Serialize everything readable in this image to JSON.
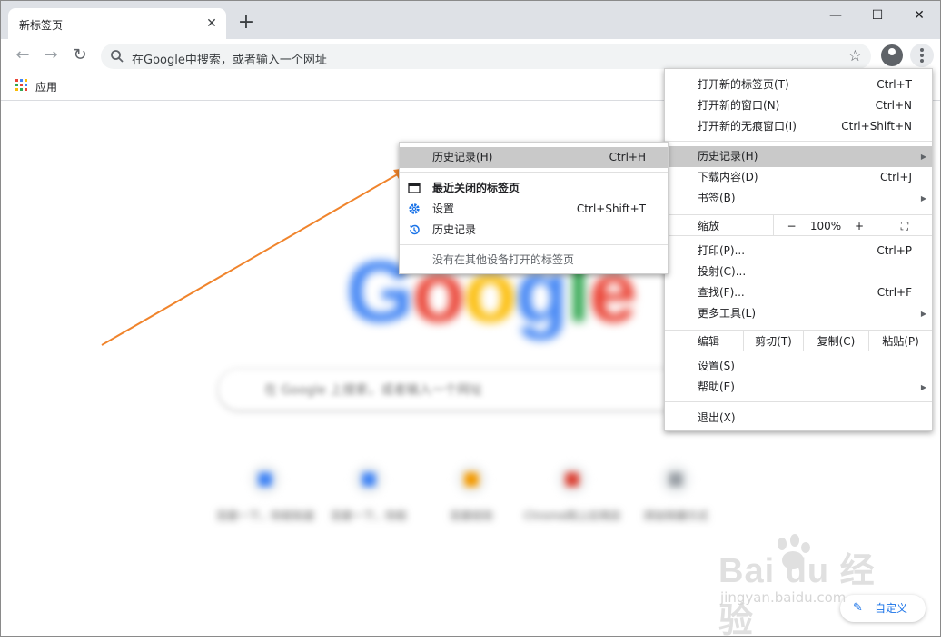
{
  "tab": {
    "title": "新标签页",
    "close": "✕",
    "new_tab": "+"
  },
  "window_controls": {
    "minimize": "—",
    "maximize": "☐",
    "close": "✕"
  },
  "omnibox": {
    "placeholder": "在Google中搜索，或者输入一个网址"
  },
  "bookmarks_bar": {
    "apps_label": "应用"
  },
  "page": {
    "logo": [
      "G",
      "o",
      "o",
      "g",
      "l",
      "e"
    ],
    "logo_colors": [
      "#4285f4",
      "#ea4335",
      "#fbbc05",
      "#4285f4",
      "#34a853",
      "#ea4335"
    ],
    "search_placeholder": "在 Google 上搜索，或者输入一个网址",
    "shortcuts": [
      {
        "label": "百度一下，你就知道",
        "color": "#4285f4"
      },
      {
        "label": "百度一下，你就",
        "color": "#4285f4"
      },
      {
        "label": "百度经验",
        "color": "#f29900"
      },
      {
        "label": "Chrome网上应用店",
        "color": "#db4437"
      },
      {
        "label": "添加快捷方式",
        "color": "#9aa0a6"
      }
    ],
    "customize_label": "自定义"
  },
  "menu": {
    "new_tab": {
      "label": "打开新的标签页(T)",
      "shortcut": "Ctrl+T"
    },
    "new_window": {
      "label": "打开新的窗口(N)",
      "shortcut": "Ctrl+N"
    },
    "incognito": {
      "label": "打开新的无痕窗口(I)",
      "shortcut": "Ctrl+Shift+N"
    },
    "history": {
      "label": "历史记录(H)"
    },
    "downloads": {
      "label": "下载内容(D)",
      "shortcut": "Ctrl+J"
    },
    "bookmarks": {
      "label": "书签(B)"
    },
    "zoom": {
      "label": "缩放",
      "minus": "−",
      "value": "100%",
      "plus": "+"
    },
    "print": {
      "label": "打印(P)...",
      "shortcut": "Ctrl+P"
    },
    "cast": {
      "label": "投射(C)..."
    },
    "find": {
      "label": "查找(F)...",
      "shortcut": "Ctrl+F"
    },
    "more_tools": {
      "label": "更多工具(L)"
    },
    "edit": {
      "label": "编辑",
      "cut": "剪切(T)",
      "copy": "复制(C)",
      "paste": "粘贴(P)"
    },
    "settings": {
      "label": "设置(S)"
    },
    "help": {
      "label": "帮助(E)"
    },
    "exit": {
      "label": "退出(X)"
    }
  },
  "history_submenu": {
    "history": {
      "label": "历史记录(H)",
      "shortcut": "Ctrl+H"
    },
    "recently_closed": {
      "label": "最近关闭的标签页"
    },
    "settings": {
      "label": "设置",
      "shortcut": "Ctrl+Shift+T"
    },
    "history_item": {
      "label": "历史记录"
    },
    "no_tabs": {
      "label": "没有在其他设备打开的标签页"
    }
  },
  "watermark": {
    "big": "Bai  du 经验",
    "small": "jingyan.baidu.com"
  },
  "colors": {
    "accent": "#1a73e8",
    "arrow": "#f0842c",
    "highlight": "#c9c9c9"
  }
}
